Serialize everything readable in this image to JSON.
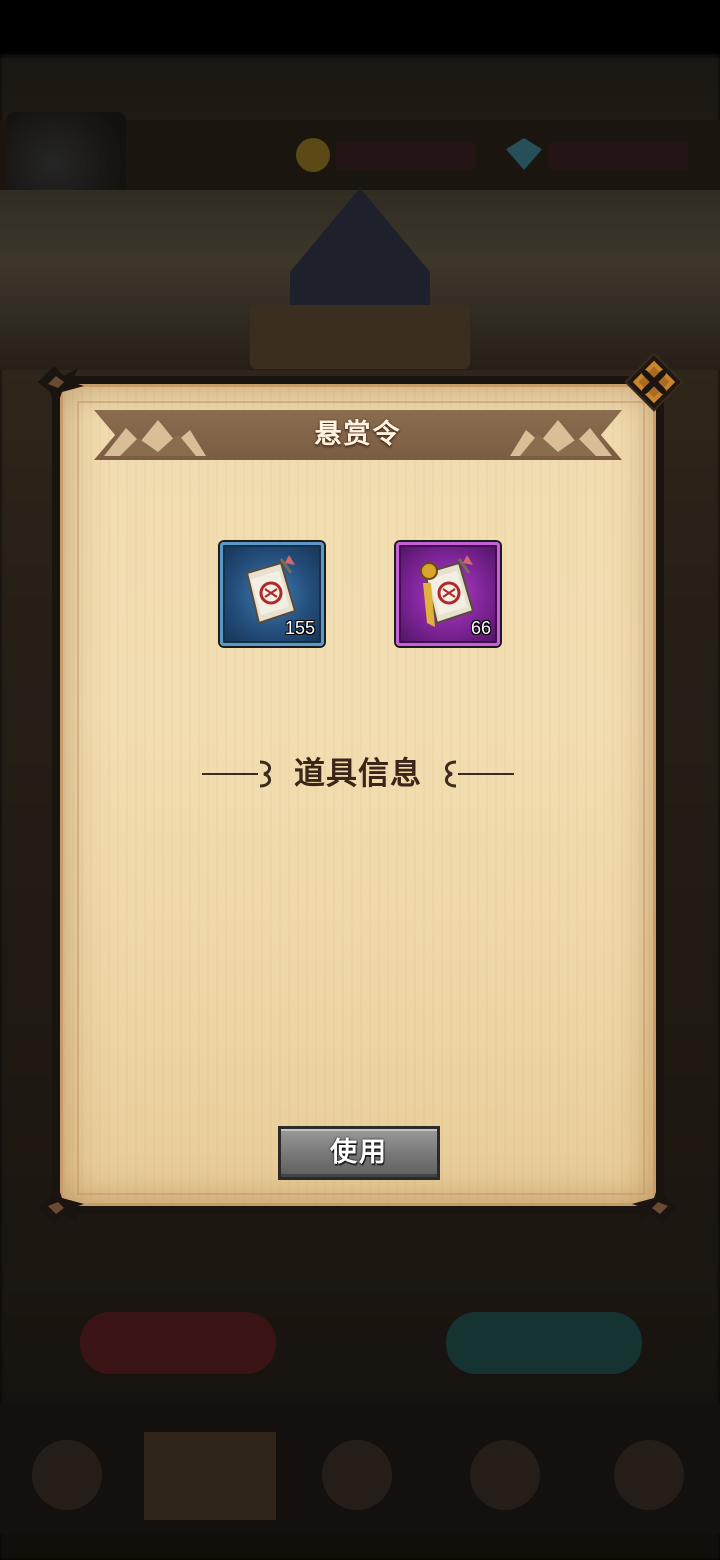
{
  "background": {
    "description_layer": "blurred game hub behind modal"
  },
  "modal": {
    "title": "悬赏令",
    "close_icon": "close-x-icon",
    "items": [
      {
        "icon": "bounty-scroll-icon",
        "rarity": "blue",
        "count": "155"
      },
      {
        "icon": "bounty-scroll-sealed-icon",
        "rarity": "purple",
        "count": "66"
      }
    ],
    "section_title": "道具信息",
    "use_label": "使用"
  },
  "colors": {
    "paper": "#f0dcaf",
    "banner": "#7b5d42",
    "blue_slot": "#244e7c",
    "purple_slot": "#7d2497",
    "button_gray": "#7a7a7a"
  }
}
